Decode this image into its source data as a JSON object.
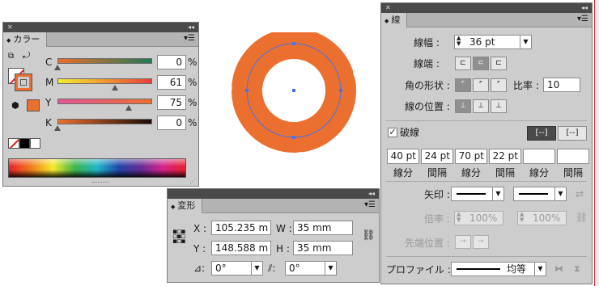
{
  "canvas": {
    "ring_color": "#eb7030",
    "path_color": "#4a6fe8"
  },
  "color_panel": {
    "tab": "カラー",
    "channels": [
      {
        "label": "C",
        "value": "0",
        "unit": "%",
        "level": 0
      },
      {
        "label": "M",
        "value": "61",
        "unit": "%",
        "level": 0.61
      },
      {
        "label": "Y",
        "value": "75",
        "unit": "%",
        "level": 0.75
      },
      {
        "label": "K",
        "value": "0",
        "unit": "%",
        "level": 0
      }
    ],
    "fill_color": "#eb6f2e"
  },
  "transform_panel": {
    "tab": "変形",
    "x_label": "X :",
    "x_value": "105.235 m",
    "y_label": "Y :",
    "y_value": "148.588 m",
    "w_label": "W :",
    "w_value": "35 mm",
    "h_label": "H :",
    "h_value": "35 mm",
    "rotate_value": "0°",
    "shear_value": "0°"
  },
  "stroke_panel": {
    "tab": "線",
    "weight_label": "線幅 :",
    "weight_value": "36 pt",
    "cap_label": "線端 :",
    "corner_label": "角の形状 :",
    "limit_label": "比率 :",
    "limit_value": "10",
    "align_label": "線の位置 :",
    "dashed_label": "破線",
    "dashed_checked": true,
    "dash_values": [
      "40 pt",
      "24 pt",
      "70 pt",
      "22 pt",
      "",
      ""
    ],
    "dash_labels": [
      "線分",
      "間隔",
      "線分",
      "間隔",
      "線分",
      "間隔"
    ],
    "arrow_label": "矢印 :",
    "scale_label": "倍率 :",
    "scale_value_1": "100%",
    "scale_value_2": "100%",
    "align_arrow_label": "先端位置 :",
    "profile_label": "プロファイル :",
    "profile_value": "均等"
  }
}
